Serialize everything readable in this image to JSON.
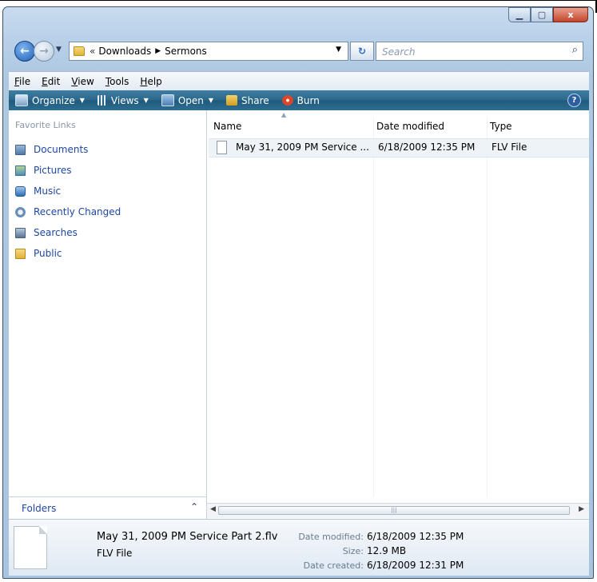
{
  "window": {
    "caption_buttons": [
      "minimize",
      "maximize",
      "close"
    ],
    "close_label": "x"
  },
  "address": {
    "overflow": "«",
    "crumbs": [
      "Downloads",
      "Sermons"
    ],
    "refresh_glyph": "↻",
    "search_placeholder": "Search"
  },
  "menu": [
    "File",
    "Edit",
    "View",
    "Tools",
    "Help"
  ],
  "commands": [
    {
      "label": "Organize",
      "icon": "organize-icon",
      "has_dropdown": true
    },
    {
      "label": "Views",
      "icon": "views-icon",
      "has_dropdown": true
    },
    {
      "label": "Open",
      "icon": "open-icon",
      "has_dropdown": true
    },
    {
      "label": "Share",
      "icon": "share-icon",
      "has_dropdown": false
    },
    {
      "label": "Burn",
      "icon": "burn-icon",
      "has_dropdown": false
    }
  ],
  "favorites": {
    "title": "Favorite Links",
    "items": [
      {
        "label": "Documents",
        "icon": "documents-icon"
      },
      {
        "label": "Pictures",
        "icon": "pictures-icon"
      },
      {
        "label": "Music",
        "icon": "music-icon"
      },
      {
        "label": "Recently Changed",
        "icon": "recently-changed-icon"
      },
      {
        "label": "Searches",
        "icon": "searches-icon"
      },
      {
        "label": "Public",
        "icon": "public-folder-icon"
      }
    ]
  },
  "folders_label": "Folders",
  "columns": {
    "name": "Name",
    "date": "Date modified",
    "type": "Type"
  },
  "files": [
    {
      "name": "May 31, 2009 PM Service ...",
      "date": "6/18/2009 12:35 PM",
      "type": "FLV File"
    }
  ],
  "details": {
    "filename": "May 31, 2009 PM Service Part 2.flv",
    "filetype": "FLV File",
    "date_modified_label": "Date modified:",
    "date_modified": "6/18/2009 12:35 PM",
    "size_label": "Size:",
    "size": "12.9 MB",
    "date_created_label": "Date created:",
    "date_created": "6/18/2009 12:31 PM"
  },
  "colors": {
    "command_bar": "#2a6689",
    "link_text": "#1e47a3",
    "frame": "#a9c4df"
  }
}
